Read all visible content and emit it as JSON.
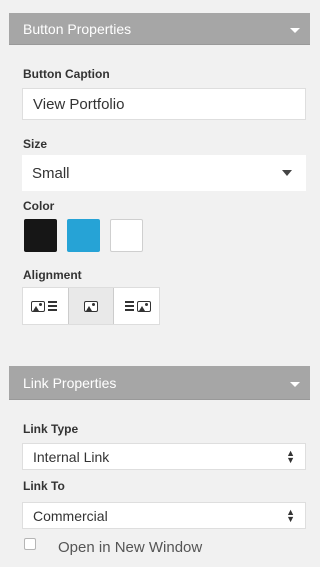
{
  "button_props": {
    "header": "Button Properties",
    "caption_label": "Button Caption",
    "caption_value": "View Portfolio",
    "size_label": "Size",
    "size_value": "Small",
    "color_label": "Color",
    "colors": [
      "#161616",
      "#26a3d6",
      "#ffffff"
    ],
    "alignment_label": "Alignment"
  },
  "link_props": {
    "header": "Link Properties",
    "link_type_label": "Link Type",
    "link_type_value": "Internal Link",
    "link_to_label": "Link To",
    "link_to_value": "Commercial",
    "new_window_label": "Open in New Window",
    "new_window_checked": false
  }
}
